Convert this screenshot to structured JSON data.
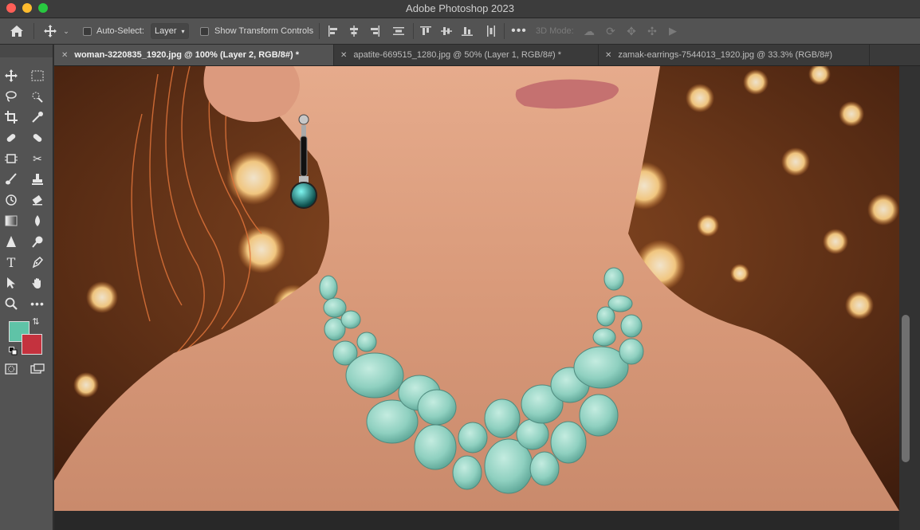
{
  "window": {
    "title": "Adobe Photoshop 2023"
  },
  "options_bar": {
    "auto_select_label": "Auto-Select:",
    "auto_select_value": "Layer",
    "show_transform_label": "Show Transform Controls",
    "mode_3d_label": "3D Mode:"
  },
  "tabs": [
    {
      "label": "woman-3220835_1920.jpg @ 100% (Layer 2, RGB/8#) *",
      "active": true
    },
    {
      "label": "apatite-669515_1280.jpg @ 50% (Layer 1, RGB/8#) *",
      "active": false
    },
    {
      "label": "zamak-earrings-7544013_1920.jpg @ 33.3% (RGB/8#)",
      "active": false
    }
  ],
  "toolbar": {
    "foreground_color": "#5fc3a7",
    "background_color": "#c4323e",
    "text_tool_label": "T"
  },
  "colors": {
    "panel": "#535353",
    "tabbar": "#3a3a3a",
    "workspace": "#323232",
    "gem": "#8fd0c0"
  }
}
